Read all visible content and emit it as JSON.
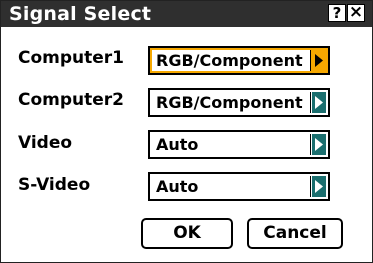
{
  "dialog": {
    "title": "Signal Select",
    "help_label": "?",
    "close_label": "×"
  },
  "rows": [
    {
      "label": "Computer1",
      "value": "RGB/Component",
      "focused": true
    },
    {
      "label": "Computer2",
      "value": "RGB/Component",
      "focused": false
    },
    {
      "label": "Video",
      "value": "Auto",
      "focused": false
    },
    {
      "label": "S-Video",
      "value": "Auto",
      "focused": false
    }
  ],
  "buttons": {
    "ok_label": "OK",
    "cancel_label": "Cancel"
  },
  "colors": {
    "titlebar": "#2f2f2f",
    "focus_accent": "#f6a800",
    "arrow_bg": "#1a6e6e"
  }
}
